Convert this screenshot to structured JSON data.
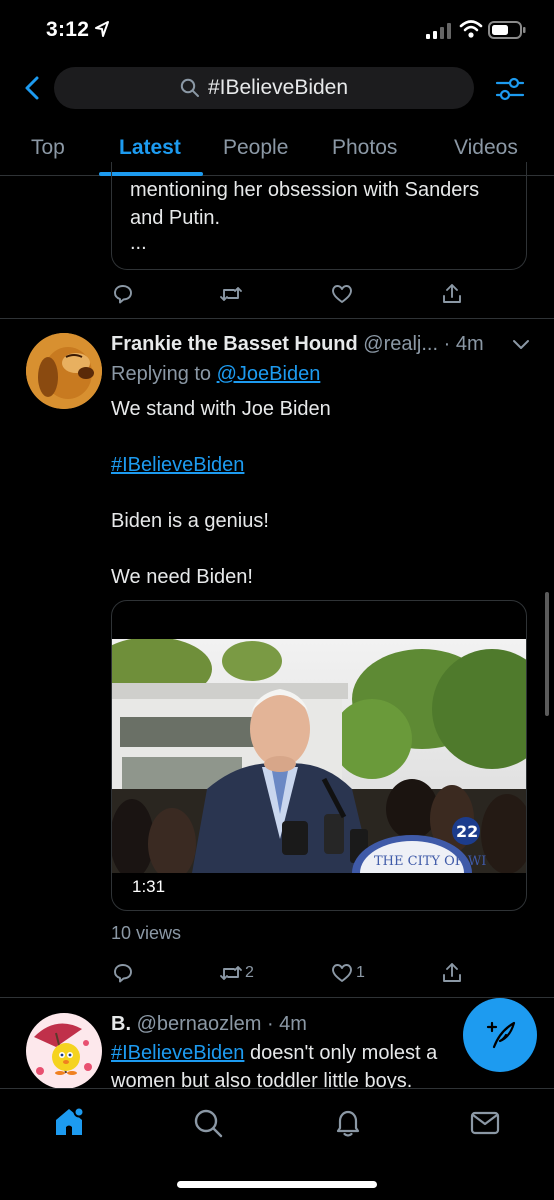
{
  "status": {
    "time": "3:12"
  },
  "search": {
    "query": "#IBelieveBiden"
  },
  "tabs": [
    {
      "label": "Top"
    },
    {
      "label": "Latest"
    },
    {
      "label": "People"
    },
    {
      "label": "Photos"
    },
    {
      "label": "Videos"
    }
  ],
  "active_tab": "Latest",
  "quoted_tweet": {
    "text": "mentioning her obsession with Sanders and Putin.",
    "ellipsis": "..."
  },
  "tweet1": {
    "name": "Frankie the Basset Hound",
    "handle": "@realj...",
    "time": "· 4m",
    "reply_prefix": "Replying to",
    "reply_to": "@JoeBiden",
    "lines": [
      "We stand with Joe Biden",
      "#IBelieveBiden",
      "Biden is a genius!",
      "We need Biden!"
    ],
    "video_duration": "1:31",
    "video_channel_badge": "22",
    "video_banner_text": "THE CITY OF WI",
    "views": "10 views",
    "retweets": "2",
    "likes": "1"
  },
  "tweet2": {
    "name": "B.",
    "handle": "@bernaozlem",
    "time": "· 4m",
    "hashtag": "#IBelieveBiden",
    "text_rest": " doesn't only molest a",
    "line2": "women but also toddler little boys."
  },
  "colors": {
    "accent": "#1d9bf0",
    "background": "#000000",
    "secondary_text": "#8b98a5",
    "divider": "#2f3336"
  },
  "icons": [
    "back-icon",
    "search-icon",
    "filter-icon",
    "reply-icon",
    "retweet-icon",
    "like-icon",
    "share-icon",
    "chevron-down-icon",
    "compose-icon",
    "home-icon",
    "explore-icon",
    "notifications-icon",
    "messages-icon"
  ]
}
